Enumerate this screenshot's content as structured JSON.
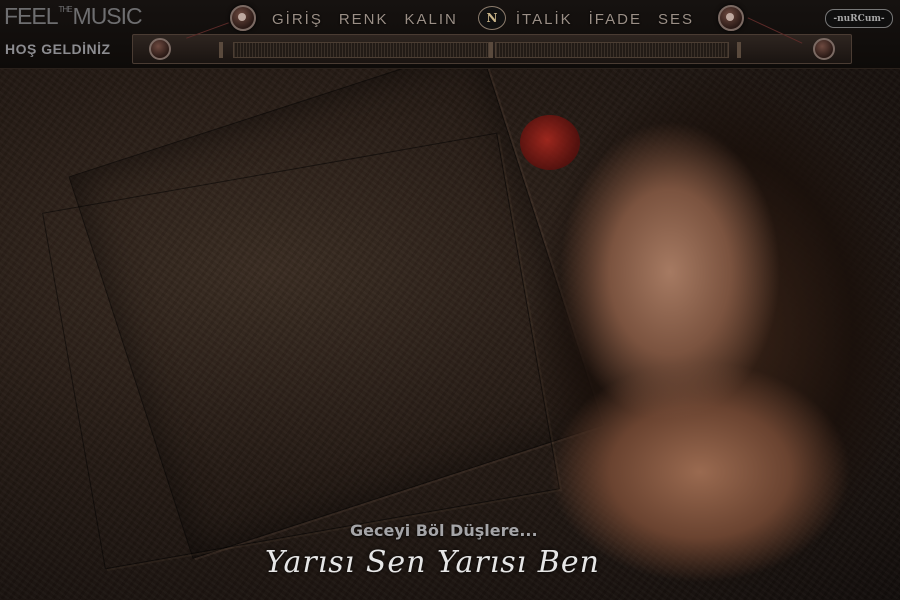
{
  "brand": {
    "feel": "FEEL",
    "the": "THE",
    "music": "MUSIC"
  },
  "welcome": "HOŞ GELDİNİZ",
  "menu": {
    "items": [
      "GİRİŞ",
      "RENK",
      "KALIN",
      "İTALİK",
      "İFADE",
      "SES"
    ],
    "badge": "N"
  },
  "logo": "-nuRCum-",
  "tagline": "Geceyi Böl Düşlere...",
  "script_line": "Yarısı Sen Yarısı Ben",
  "colors": {
    "accent": "#9b8f86",
    "background": "#17120f",
    "rose": "#b0281e"
  }
}
